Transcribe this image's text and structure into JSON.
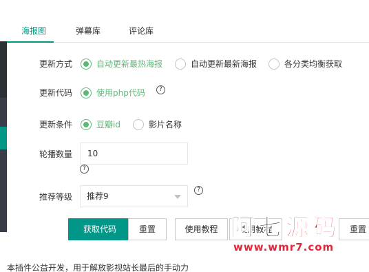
{
  "tabs": [
    {
      "label": "海报图",
      "active": true
    },
    {
      "label": "弹幕库",
      "active": false
    },
    {
      "label": "评论库",
      "active": false
    }
  ],
  "update_mode": {
    "label": "更新方式",
    "options": [
      {
        "label": "自动更新最热海报",
        "checked": true
      },
      {
        "label": "自动更新最新海报",
        "checked": false
      },
      {
        "label": "各分类均衡获取",
        "checked": false
      }
    ]
  },
  "update_code": {
    "label": "更新代码",
    "options": [
      {
        "label": "使用php代码",
        "checked": true
      }
    ],
    "help": "?"
  },
  "update_condition": {
    "label": "更新条件",
    "options": [
      {
        "label": "豆瓣id",
        "checked": true
      },
      {
        "label": "影片名称",
        "checked": false
      }
    ]
  },
  "carousel_count": {
    "label": "轮播数量",
    "value": "10",
    "help": "?"
  },
  "recommend_level": {
    "label": "推荐等级",
    "selected": "推荐9",
    "help": "?"
  },
  "buttons": {
    "get_code": "获取代码",
    "reset": "重置",
    "tutorial": "使用教程",
    "tutorial2": "使用教程",
    "reset2": "重置"
  },
  "footer": "本插件公益开发，用于解放影视站长最后的手动力",
  "watermark": {
    "title": "阿七源码",
    "url": "www.wmr7.com"
  },
  "colors": {
    "accent": "#009688",
    "radio_checked": "#5fb878",
    "sidebar_dark": "#393d49"
  }
}
